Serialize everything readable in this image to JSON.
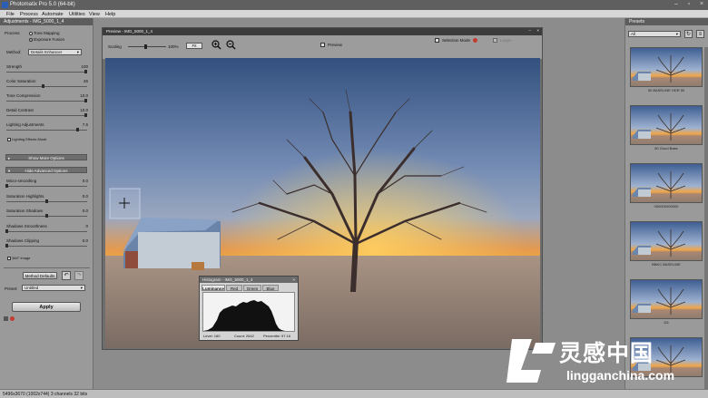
{
  "window": {
    "title": "Photomatix Pro 5.0 (64-bit)"
  },
  "menu": [
    "File",
    "Process",
    "Automate",
    "Utilities",
    "View",
    "Help"
  ],
  "adjustments": {
    "header": "Adjustments - IMG_5000_1_4",
    "process_label": "Process:",
    "process_options": [
      "Tone Mapping",
      "Exposure Fusion"
    ],
    "process_selected": 0,
    "method_label": "Method:",
    "method_value": "Details Enhancer",
    "sliders": [
      {
        "label": "Strength",
        "value": "100",
        "level": 1.0
      },
      {
        "label": "Color Saturation",
        "value": "46",
        "level": 0.46
      },
      {
        "label": "Tone Compression",
        "value": "10.0",
        "level": 1.0
      },
      {
        "label": "Detail Contrast",
        "value": "10.0",
        "level": 1.0
      },
      {
        "label": "Lighting Adjustments",
        "value": "7.6",
        "level": 0.9
      }
    ],
    "lighting_effects_mode": "Lighting Effects Mode",
    "show_more_options": "Show More Options",
    "hide_advanced_options": "Hide Advanced Options",
    "advanced_sliders": [
      {
        "label": "Micro-smoothing",
        "value": "0.0",
        "level": 0.0
      },
      {
        "label": "Saturation Highlights",
        "value": "0.0",
        "level": 0.5
      },
      {
        "label": "Saturation Shadows",
        "value": "0.0",
        "level": 0.5
      },
      {
        "label": "Shadows Smoothness",
        "value": "0",
        "level": 0.0
      },
      {
        "label": "Shadows Clipping",
        "value": "0.0",
        "level": 0.0
      }
    ],
    "panel360_label": "360° image",
    "method_defaults": "Method Defaults",
    "preset_label": "Preset:",
    "preset_value": "Untitled",
    "apply_label": "Apply"
  },
  "preview": {
    "header": "Preview - IMG_5000_1_4",
    "scaling_label": "Scaling",
    "scaling_value": "100%",
    "fit_label": "Fit",
    "preview_label": "Preview",
    "selection_mode_label": "Selection Mode",
    "loupe_label": "Loupe",
    "zoom_in_icon": "zoom-in-icon",
    "zoom_out_icon": "zoom-out-icon"
  },
  "histogram": {
    "header": "Histogram - IMG_5000_1_4",
    "tabs": [
      "Luminance",
      "Red",
      "Green",
      "Blue"
    ],
    "active_tab": 0,
    "level": "Level: 180",
    "count": "Count: 2642",
    "percentile": "Percentile: 97.16"
  },
  "presets": {
    "header": "Presets",
    "filter": "All",
    "items": [
      {
        "caption": "50 BASELINE HDR 50"
      },
      {
        "caption": "50 Good Base"
      },
      {
        "caption": "000000000000"
      },
      {
        "caption": "BBKC BASELINE"
      },
      {
        "caption": "111"
      },
      {
        "caption": ""
      }
    ]
  },
  "statusbar": {
    "text": "5496x3670 (1002x744) 3 channels 32 bits"
  },
  "watermark": {
    "cn": "灵感中国",
    "en": "lingganchina.com"
  },
  "colors": {
    "accent": "#c43b2f",
    "panel": "#9a9a9a",
    "header": "#5d5d5d"
  }
}
